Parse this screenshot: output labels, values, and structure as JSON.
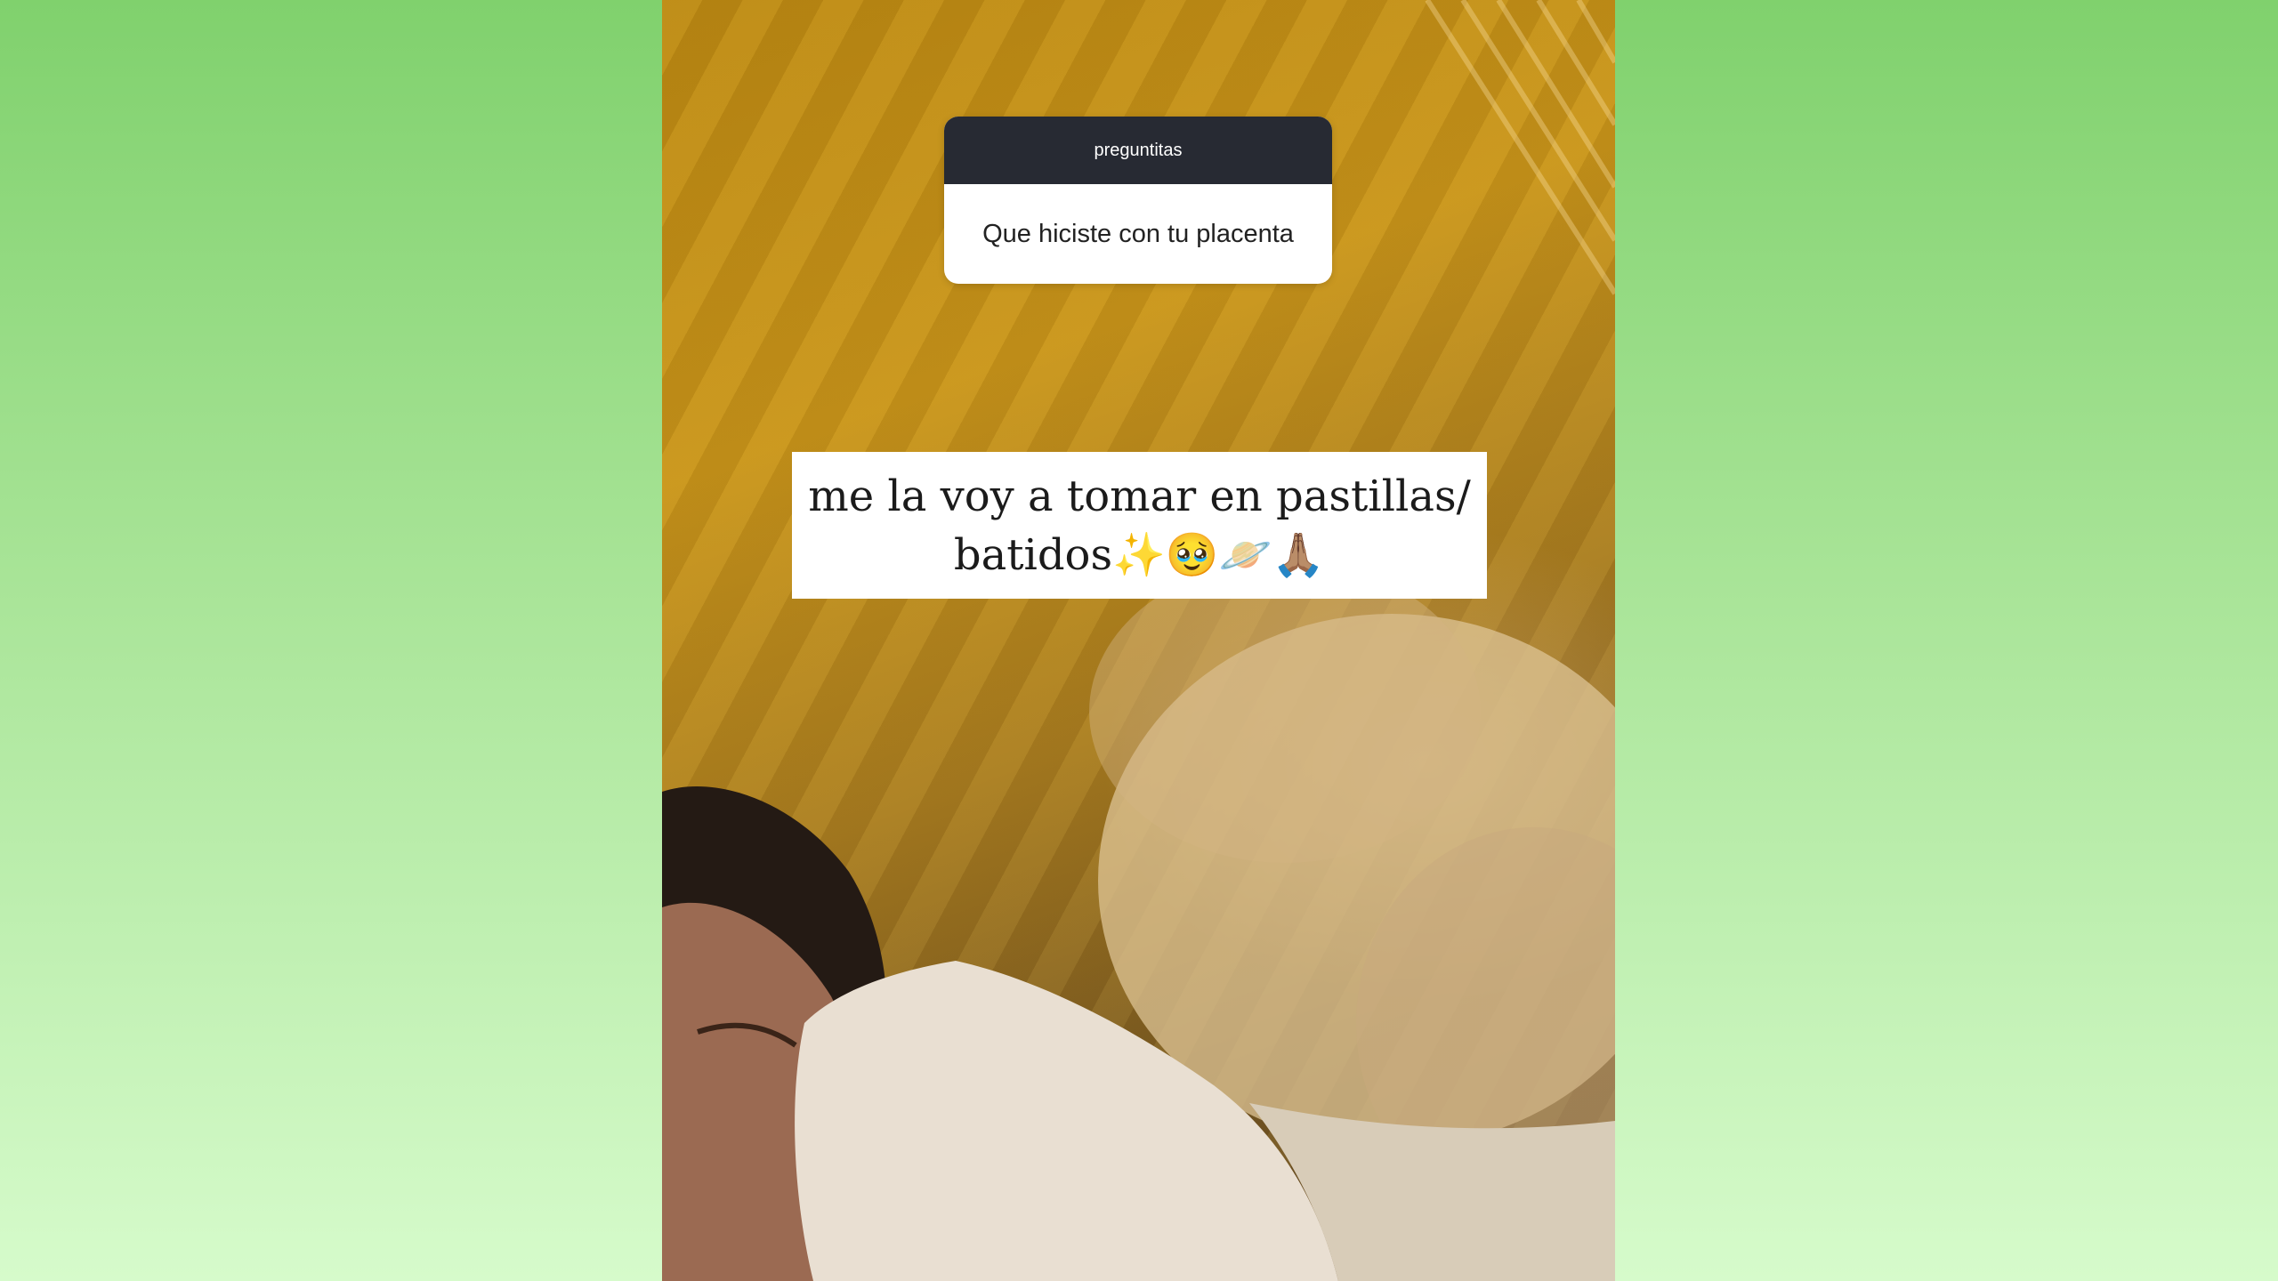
{
  "story": {
    "question_sticker": {
      "header": "preguntitas",
      "question": "Que hiciste con tu placenta"
    },
    "answer": {
      "line1": "me la voy a tomar en pastillas/",
      "line2": "batidos✨🥹🪐🙏🏽"
    },
    "photo": "person-sleeping-with-fluffy-blanket-photo"
  },
  "colors": {
    "background_top": "#80d16d",
    "background_bottom": "#d6fbcb",
    "sticker_header": "#272a33"
  }
}
